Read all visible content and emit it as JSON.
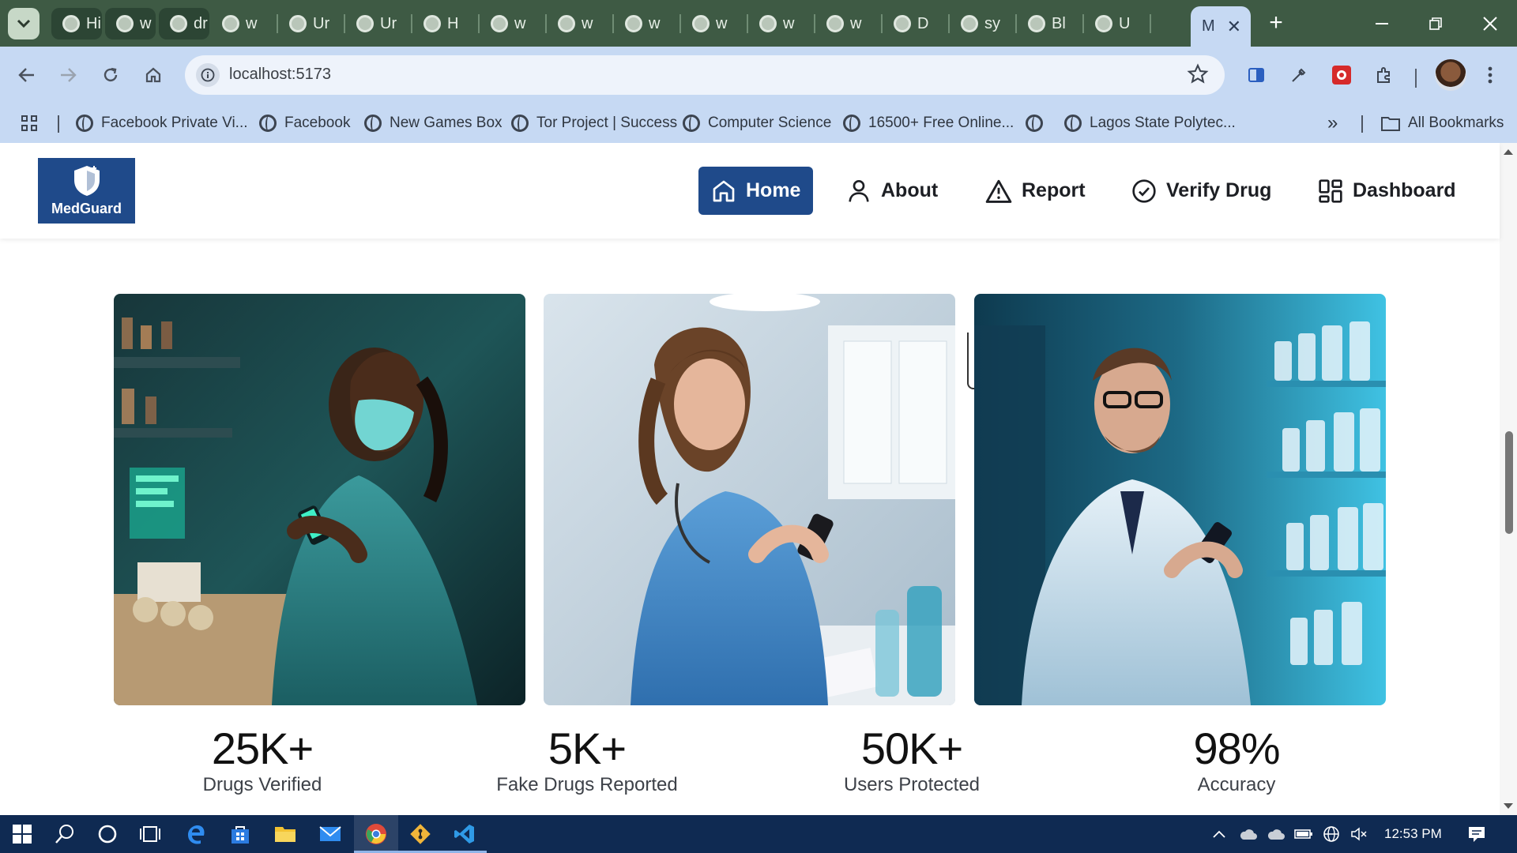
{
  "browser": {
    "tabs": [
      {
        "label": "Hi",
        "grouped": true
      },
      {
        "label": "w",
        "grouped": true
      },
      {
        "label": "dr",
        "grouped": true
      },
      {
        "label": "w",
        "grouped": false
      },
      {
        "label": "Ur",
        "grouped": false
      },
      {
        "label": "Ur",
        "grouped": false
      },
      {
        "label": "H",
        "grouped": false
      },
      {
        "label": "w",
        "grouped": false
      },
      {
        "label": "w",
        "grouped": false
      },
      {
        "label": "w",
        "grouped": false
      },
      {
        "label": "w",
        "grouped": false
      },
      {
        "label": "w",
        "grouped": false
      },
      {
        "label": "w",
        "grouped": false
      },
      {
        "label": "D",
        "grouped": false
      },
      {
        "label": "sy",
        "grouped": false
      },
      {
        "label": "Bl",
        "grouped": false
      },
      {
        "label": "U",
        "grouped": false
      }
    ],
    "active_tab": {
      "label": "M",
      "close": "✕"
    },
    "new_tab": "+",
    "url": "localhost:5173",
    "bookmarks": [
      "Facebook Private Vi...",
      "Facebook",
      "New Games Box",
      "Tor Project | Success",
      "Computer Science",
      "16500+ Free Online...",
      "",
      "Lagos State Polytec..."
    ],
    "bookmarks_overflow": "»",
    "all_bookmarks": "All Bookmarks"
  },
  "site": {
    "logo_text": "MedGuard",
    "nav": {
      "home": "Home",
      "about": "About",
      "report": "Report",
      "verify": "Verify Drug",
      "dashboard": "Dashboard"
    },
    "images": [
      {
        "alt": "Pharmacist in mask checking phone",
        "tone": "teal"
      },
      {
        "alt": "Nurse in scrubs using phone",
        "tone": "blue"
      },
      {
        "alt": "Pharmacist in lab coat scanning shelves",
        "tone": "cyan"
      }
    ],
    "stats": [
      {
        "value": "25K+",
        "label": "Drugs Verified"
      },
      {
        "value": "5K+",
        "label": "Fake Drugs Reported"
      },
      {
        "value": "50K+",
        "label": "Users Protected"
      },
      {
        "value": "98%",
        "label": "Accuracy"
      }
    ]
  },
  "taskbar": {
    "time": "12:53 PM"
  },
  "colors": {
    "brand": "#1f4a8a",
    "tab_strip": "#3e5a44",
    "toolbar": "#c6d9f3",
    "taskbar": "#0f2a52"
  }
}
